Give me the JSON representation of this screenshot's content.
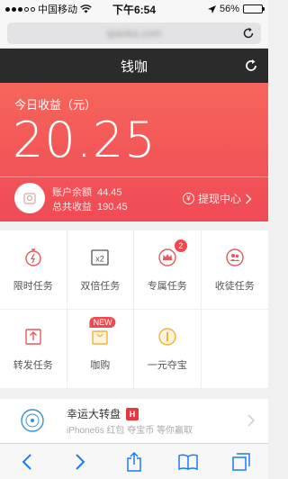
{
  "status_bar": {
    "carrier": "中国移动",
    "time": "下午6:54",
    "battery": "56%",
    "battery_level": 0.56,
    "wifi_icon": "wifi-icon",
    "location_icon": "location-arrow-icon"
  },
  "browser": {
    "url": "qianka.com",
    "reload_icon": "reload-icon"
  },
  "app_header": {
    "title": "钱咖",
    "refresh_icon": "refresh-icon"
  },
  "earnings": {
    "today_label": "今日收益（元）",
    "today_amount": "20.25",
    "balance_label": "账户余额",
    "balance_value": "44.45",
    "total_label": "总共收益",
    "total_value": "190.45",
    "withdraw_icon": "yen-circle-icon",
    "withdraw_label": "提现中心",
    "accent_color": "#ef4b55"
  },
  "tasks": [
    {
      "label": "限时任务",
      "icon": "stopwatch-icon"
    },
    {
      "label": "双倍任务",
      "icon": "x2-icon"
    },
    {
      "label": "专属任务",
      "icon": "crown-icon",
      "badge": "2"
    },
    {
      "label": "收徒任务",
      "icon": "apprentice-icon"
    },
    {
      "label": "转发任务",
      "icon": "share-icon"
    },
    {
      "label": "咖购",
      "icon": "shopping-bag-icon",
      "tag": "NEW"
    },
    {
      "label": "一元夺宝",
      "icon": "treasure-coin-icon"
    },
    {
      "label": "",
      "icon": ""
    }
  ],
  "promo": {
    "title": "幸运大转盘",
    "badge": "H",
    "subtitle": "iPhone6s 红包 夺宝币 等你赢取",
    "icon": "disc-icon"
  },
  "toolbar": {
    "back_icon": "back-icon",
    "forward_icon": "forward-icon",
    "share_icon": "share-icon",
    "bookmarks_icon": "bookmarks-icon",
    "tabs_icon": "tabs-icon"
  }
}
